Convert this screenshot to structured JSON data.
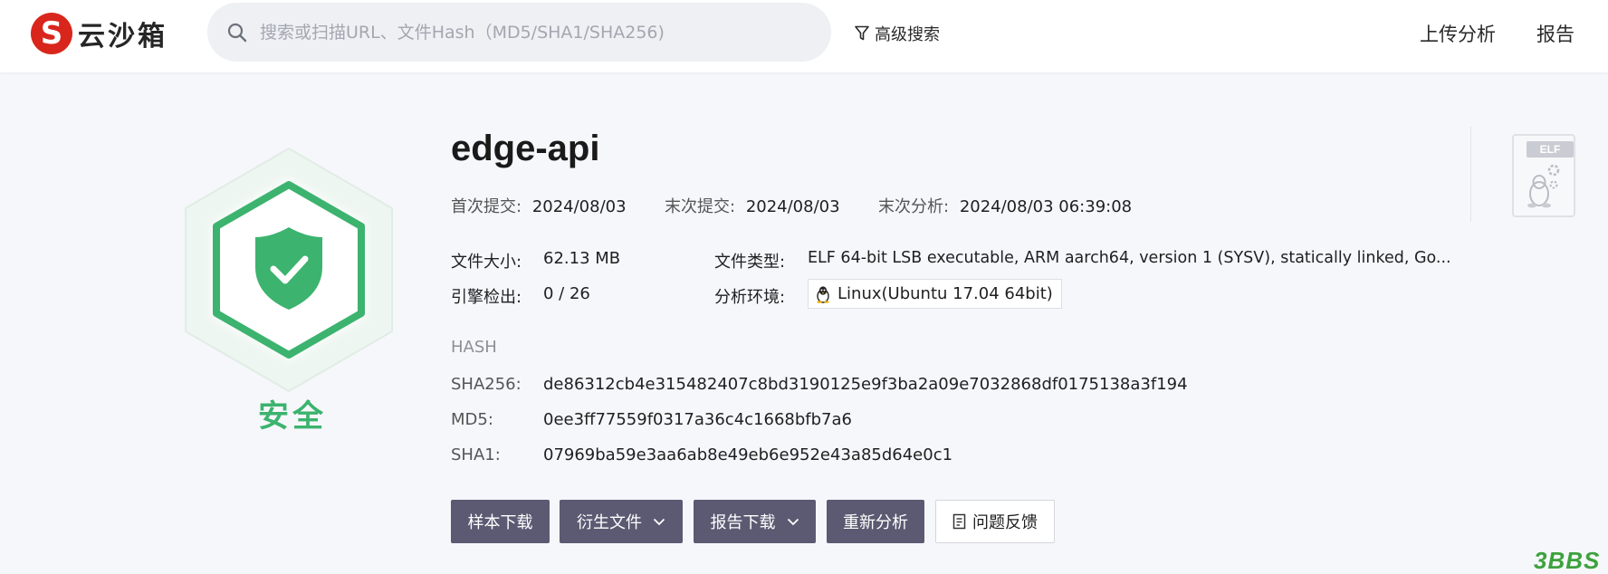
{
  "header": {
    "logo_text": "云沙箱",
    "search_placeholder": "搜索或扫描URL、文件Hash（MD5/SHA1/SHA256)",
    "advanced_search": "高级搜索",
    "nav": {
      "upload": "上传分析",
      "report": "报告"
    }
  },
  "verdict": {
    "label": "安全",
    "color": "#3cb36e"
  },
  "file": {
    "name": "edge-api",
    "first_submit_label": "首次提交:",
    "first_submit": "2024/08/03",
    "last_submit_label": "末次提交:",
    "last_submit": "2024/08/03",
    "last_analysis_label": "末次分析:",
    "last_analysis": "2024/08/03 06:39:08",
    "size_label": "文件大小:",
    "size": "62.13 MB",
    "type_label": "文件类型:",
    "type": "ELF 64-bit LSB executable, ARM aarch64, version 1 (SYSV), statically linked, Go...",
    "engines_label": "引擎检出:",
    "engines": "0 / 26",
    "env_label": "分析环境:",
    "env": "Linux(Ubuntu 17.04 64bit)"
  },
  "hash": {
    "heading": "HASH",
    "sha256_label": "SHA256:",
    "sha256": "de86312cb4e315482407c8bd3190125e9f3ba2a09e7032868df0175138a3f194",
    "md5_label": "MD5:",
    "md5": "0ee3ff77559f0317a36c4c1668bfb7a6",
    "sha1_label": "SHA1:",
    "sha1": "07969ba59e3aa6ab8e49eb6e952e43a85d64e0c1"
  },
  "actions": {
    "sample_download": "样本下载",
    "derived_files": "衍生文件",
    "report_download": "报告下载",
    "reanalyze": "重新分析",
    "feedback": "问题反馈"
  },
  "thumb": {
    "tag": "ELF"
  },
  "watermark": "3BBS"
}
